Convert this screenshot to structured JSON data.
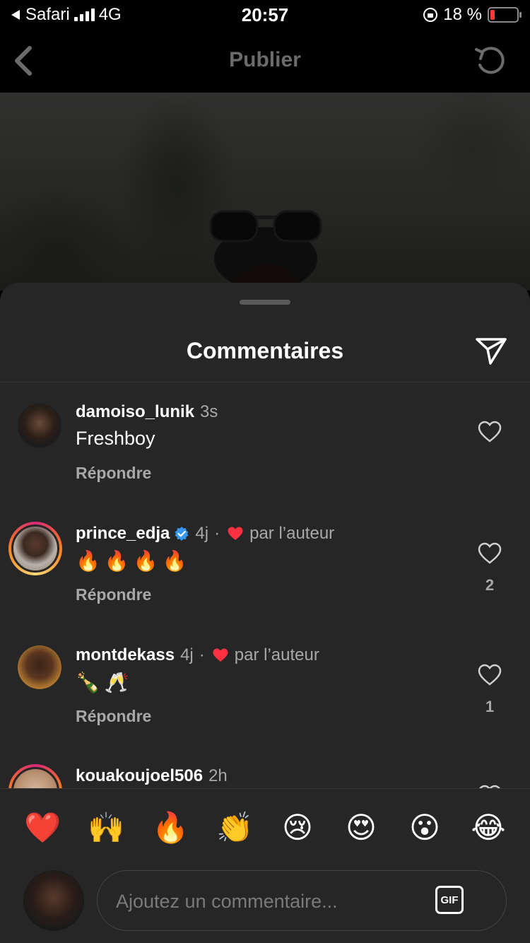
{
  "status_bar": {
    "carrier": "Safari",
    "network": "4G",
    "time": "20:57",
    "battery": "18 %",
    "battery_level": 0.18,
    "battery_color": "#ff3b30"
  },
  "header": {
    "title": "Publier",
    "back_icon": "chevron-left-icon",
    "undo_icon": "undo-icon"
  },
  "sheet": {
    "title": "Commentaires",
    "send_icon": "paper-plane-icon"
  },
  "comments": [
    {
      "username": "damoiso_lunik",
      "time": "3s",
      "text": "Freshboy",
      "reply_label": "Répondre",
      "liked_by_author": false,
      "likes": ""
    },
    {
      "username": "prince_edja",
      "verified": true,
      "time": "4j",
      "author_label": "par l’auteur",
      "text": "🔥🔥🔥🔥",
      "reply_label": "Répondre",
      "liked_by_author": true,
      "likes": "2"
    },
    {
      "username": "montdekass",
      "time": "4j",
      "author_label": "par l’auteur",
      "text": "🍾🥂",
      "reply_label": "Répondre",
      "liked_by_author": true,
      "likes": "1"
    },
    {
      "username": "kouakoujoel506",
      "time": "2h"
    }
  ],
  "reactions": [
    "❤️",
    "🙌",
    "🔥",
    "👏",
    "😢",
    "😍",
    "😮",
    "😂"
  ],
  "composer": {
    "placeholder": "Ajoutez un commentaire...",
    "gif_label": "GIF"
  },
  "colors": {
    "sheet_bg": "#262626",
    "secondary_text": "#a8a8a8",
    "heart_red": "#ff3040",
    "verified_blue": "#3897f0"
  }
}
